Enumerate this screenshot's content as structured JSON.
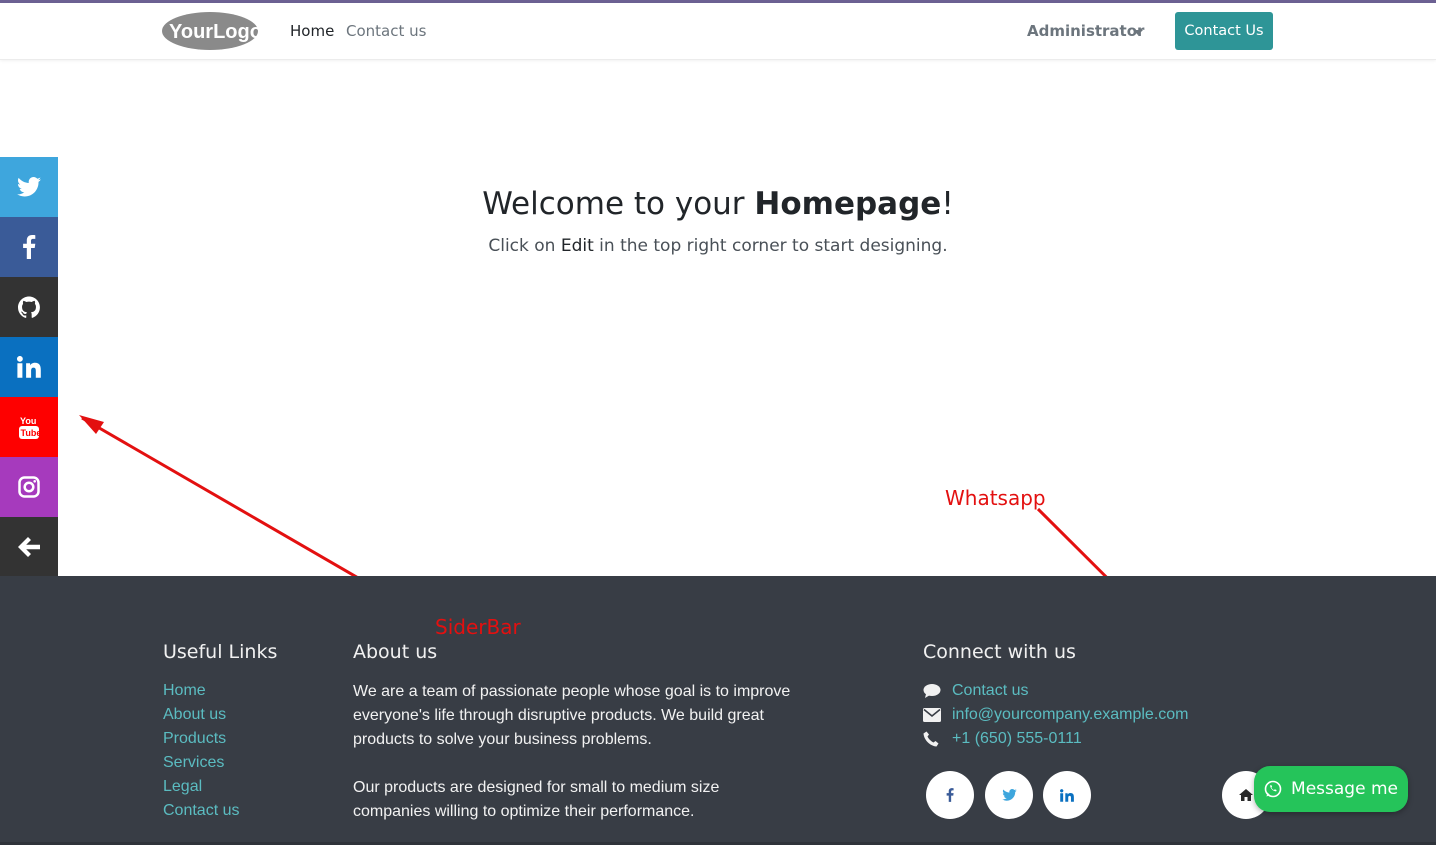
{
  "header": {
    "logo_text": "YourLogo",
    "nav": [
      {
        "label": "Home"
      },
      {
        "label": "Contact us"
      }
    ],
    "user_menu": "Administrator",
    "cta": "Contact Us"
  },
  "hero": {
    "title_prefix": "Welcome to your ",
    "title_bold": "Homepage",
    "title_suffix": "!",
    "sub_prefix": "Click on ",
    "sub_edit": "Edit",
    "sub_suffix": " in the top right corner to start designing."
  },
  "sidebar": {
    "items": [
      {
        "icon": "twitter-icon",
        "color": "#3ea6dd"
      },
      {
        "icon": "facebook-icon",
        "color": "#3a5b98"
      },
      {
        "icon": "github-icon",
        "color": "#333333"
      },
      {
        "icon": "linkedin-icon",
        "color": "#0a70c0"
      },
      {
        "icon": "youtube-icon",
        "color": "#fe0000"
      },
      {
        "icon": "instagram-icon",
        "color": "#a63abd"
      },
      {
        "icon": "arrow-left-icon",
        "color": "#333333"
      }
    ]
  },
  "annotations": {
    "sidebar_label": "SiderBar",
    "whatsapp_label": "Whatsapp",
    "color": "#e31010"
  },
  "footer": {
    "useful_links_title": "Useful Links",
    "useful_links": [
      "Home",
      "About us",
      "Products",
      "Services",
      "Legal",
      "Contact us"
    ],
    "about_title": "About us",
    "about_p1": "We are a team of passionate people whose goal is to improve everyone's life through disruptive products. We build great products to solve your business problems.",
    "about_p2": "Our products are designed for small to medium size companies willing to optimize their performance.",
    "connect_title": "Connect with us",
    "contact_link": "Contact us",
    "email": "info@yourcompany.example.com",
    "phone": "+1 (650) 555-0111",
    "social": [
      "facebook-icon",
      "twitter-icon",
      "linkedin-icon"
    ],
    "whatsapp_button": "Message me",
    "link_color": "#5bbcc1",
    "whatsapp_color": "#25c45a"
  }
}
